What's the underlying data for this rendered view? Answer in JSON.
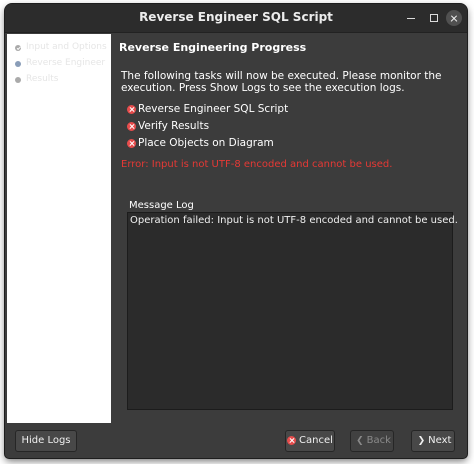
{
  "window": {
    "title": "Reverse Engineer SQL Script"
  },
  "sidebar": {
    "steps": [
      {
        "label": "Input and Options",
        "state": "done"
      },
      {
        "label": "Reverse Engineer",
        "state": "current"
      },
      {
        "label": "Results",
        "state": "pending"
      }
    ]
  },
  "main": {
    "heading": "Reverse Engineering Progress",
    "description": "The following tasks will now be executed. Please monitor the execution. Press Show Logs to see the execution logs.",
    "tasks": [
      {
        "label": "Reverse Engineer SQL Script",
        "status": "failed"
      },
      {
        "label": "Verify Results",
        "status": "failed"
      },
      {
        "label": "Place Objects on Diagram",
        "status": "failed"
      }
    ],
    "error": "Error: Input is not UTF-8 encoded and cannot be used.",
    "log": {
      "title": "Message Log",
      "text": "Operation failed: Input is not UTF-8 encoded and cannot be used."
    }
  },
  "buttons": {
    "hide_logs": "Hide Logs",
    "cancel": "Cancel",
    "back": "Back",
    "next": "Next"
  },
  "colors": {
    "error": "#e53935",
    "fail_icon": "#e74c4c",
    "window_bg": "#3c3c3c"
  }
}
